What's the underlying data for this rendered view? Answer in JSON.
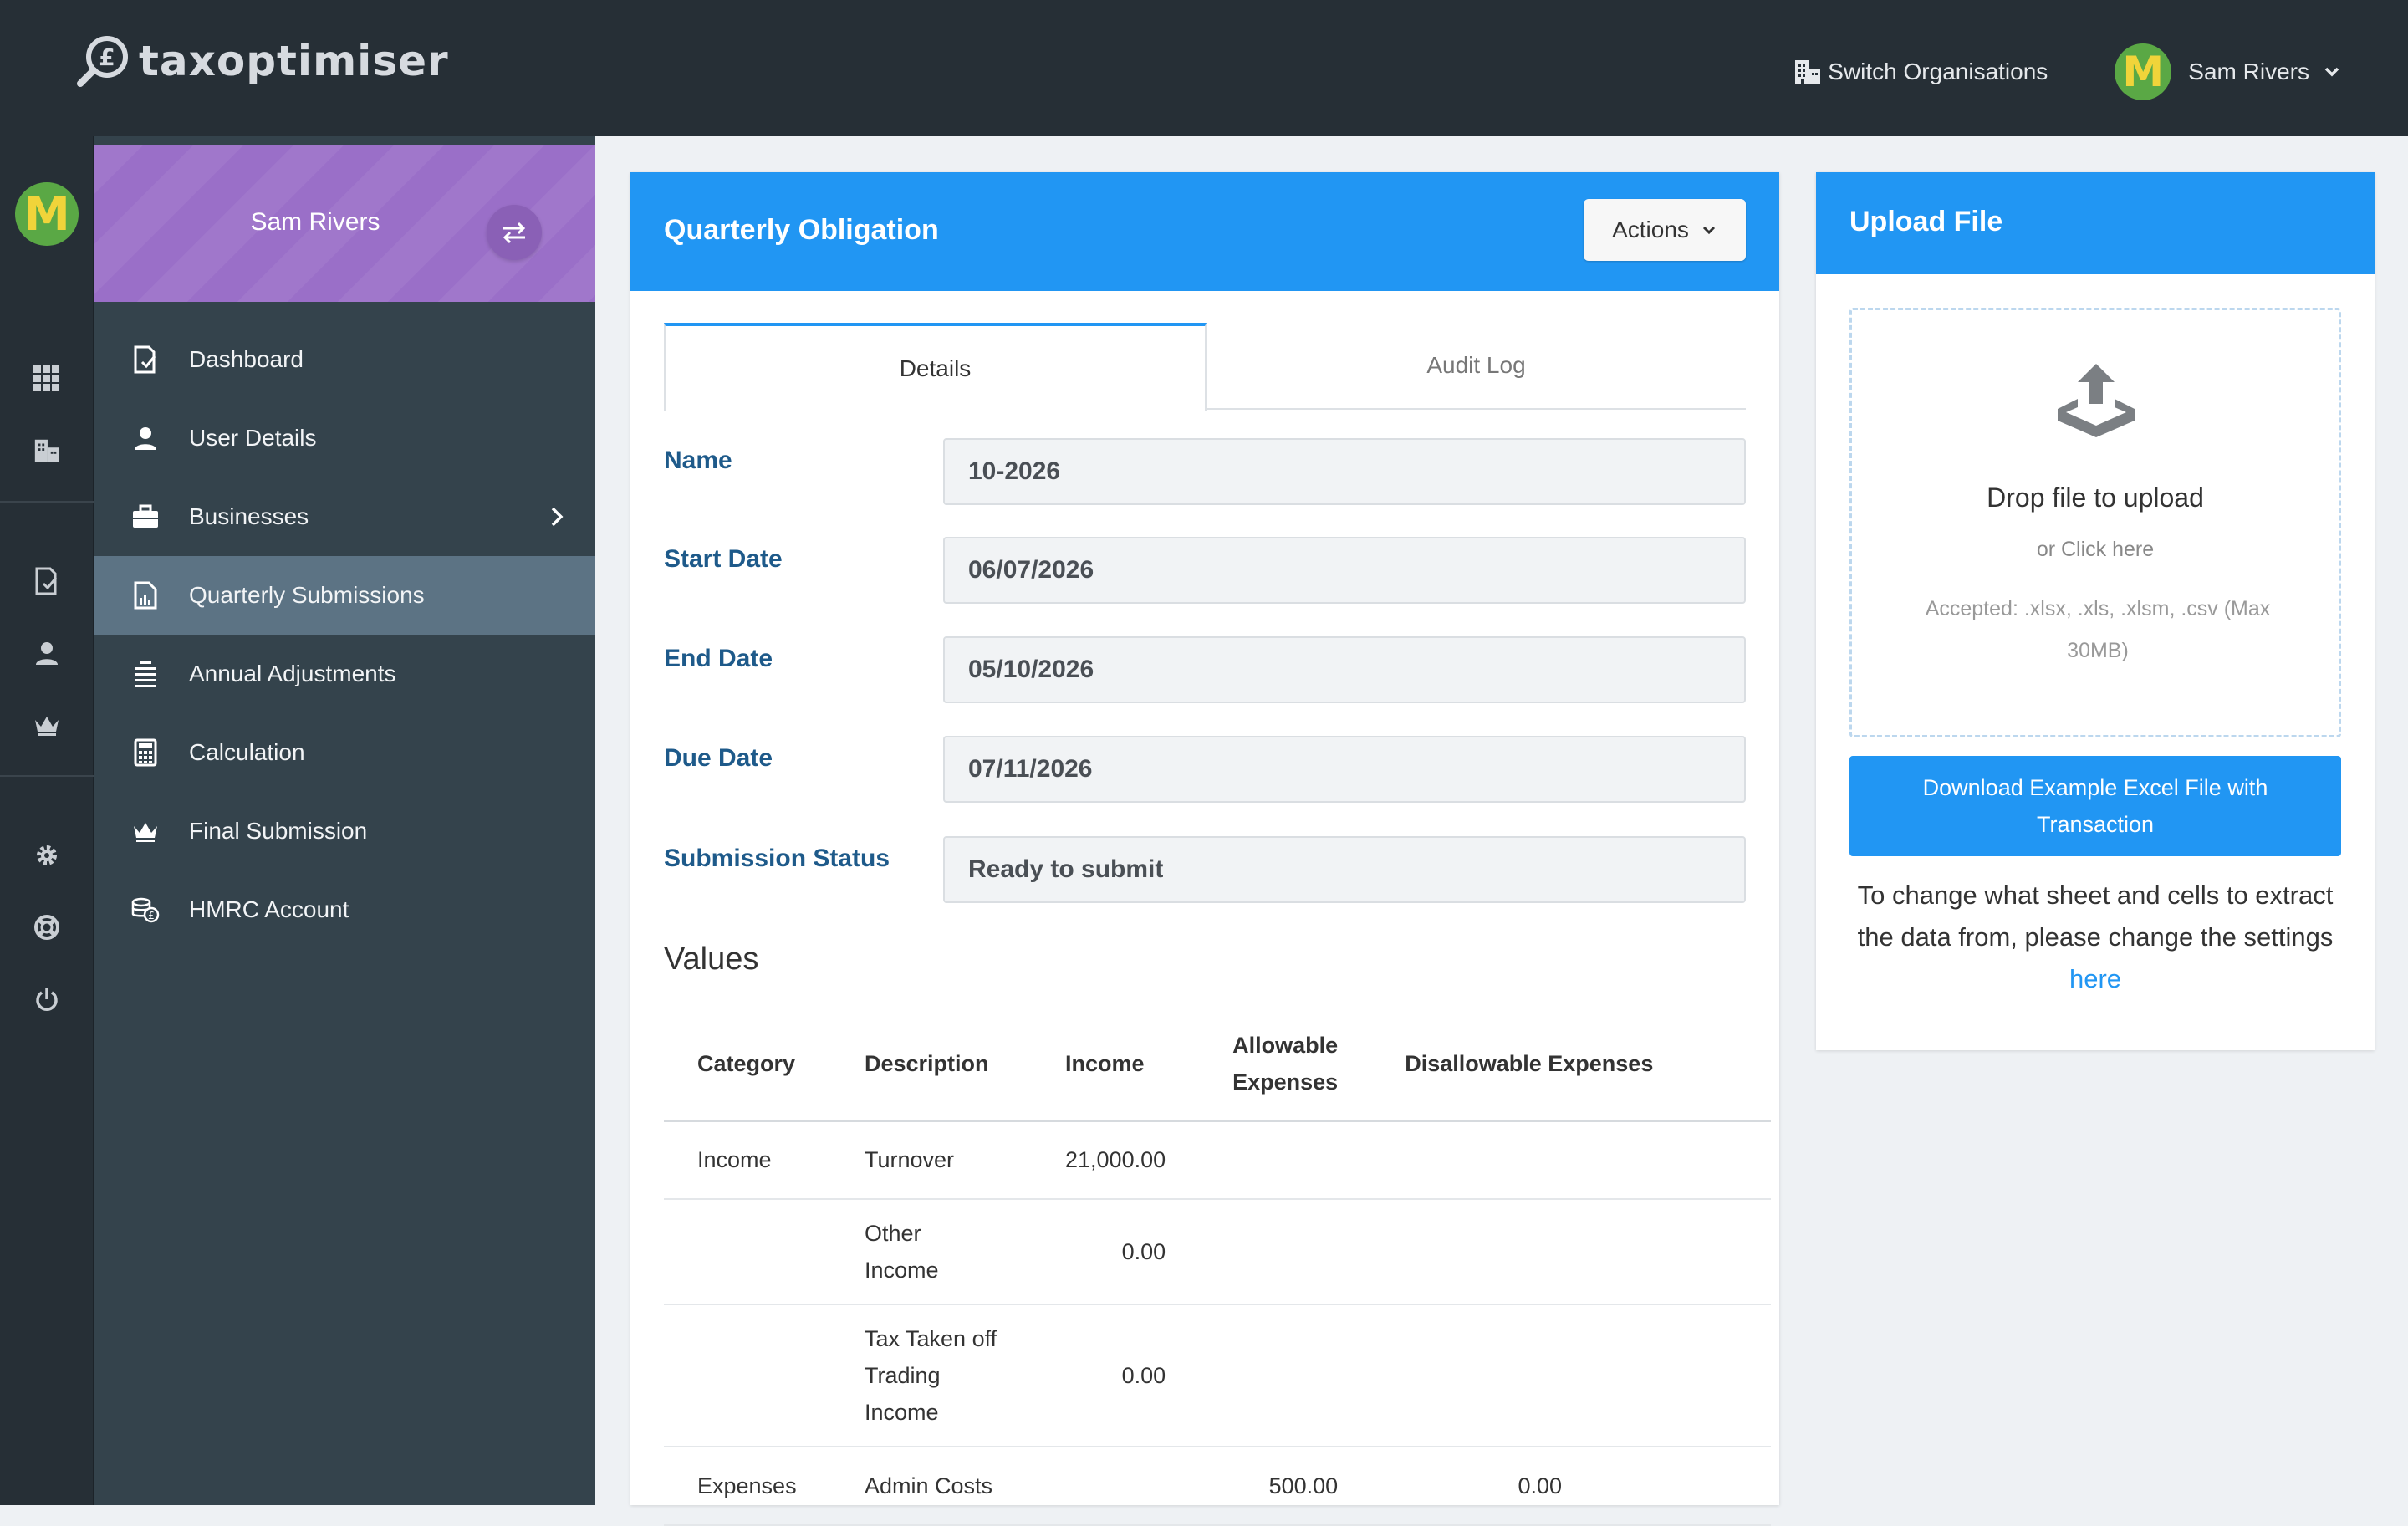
{
  "brand": {
    "logo_text": "taxoptimiser"
  },
  "topbar": {
    "switch_org_label": "Switch Organisations",
    "user_name": "Sam Rivers",
    "avatar_letter": "M"
  },
  "rail": {
    "avatar_letter": "M"
  },
  "sidebar": {
    "user_name": "Sam Rivers",
    "items": [
      {
        "label": "Dashboard",
        "icon": "document-check-icon"
      },
      {
        "label": "User Details",
        "icon": "user-icon"
      },
      {
        "label": "Businesses",
        "icon": "briefcase-icon"
      },
      {
        "label": "Quarterly Submissions",
        "icon": "report-icon",
        "active": true
      },
      {
        "label": "Annual Adjustments",
        "icon": "list-icon"
      },
      {
        "label": "Calculation",
        "icon": "calculator-icon"
      },
      {
        "label": "Final Submission",
        "icon": "crown-icon"
      },
      {
        "label": "HMRC Account",
        "icon": "coins-icon"
      }
    ]
  },
  "obligation": {
    "title": "Quarterly Obligation",
    "actions_label": "Actions",
    "tabs": [
      "Details",
      "Audit Log"
    ],
    "fields": [
      {
        "label": "Name",
        "value": "10-2026"
      },
      {
        "label": "Start Date",
        "value": "06/07/2026"
      },
      {
        "label": "End Date",
        "value": "05/10/2026"
      },
      {
        "label": "Due Date",
        "value": "07/11/2026"
      },
      {
        "label": "Submission Status",
        "value": "Ready to submit"
      }
    ],
    "values_title": "Values",
    "table": {
      "headers": [
        "Category",
        "Description",
        "Income",
        "Allowable Expenses",
        "Disallowable Expenses"
      ],
      "rows": [
        [
          "Income",
          "Turnover",
          "21,000.00",
          "",
          ""
        ],
        [
          "",
          "Other Income",
          "0.00",
          "",
          ""
        ],
        [
          "",
          "Tax Taken off Trading Income",
          "0.00",
          "",
          ""
        ],
        [
          "Expenses",
          "Admin Costs",
          "",
          "500.00",
          "0.00"
        ]
      ]
    }
  },
  "upload": {
    "title": "Upload File",
    "drop_title": "Drop file to upload",
    "drop_or": "or Click here",
    "accepted": "Accepted: .xlsx, .xls, .xlsm, .csv (Max 30MB)",
    "download_label": "Download Example Excel File with Transaction",
    "note_text": "To change what sheet and cells to extract the data from, please change the settings",
    "note_link": "here"
  },
  "colors": {
    "topbar": "#262f36",
    "sidebar": "#34434c",
    "sidebar_header": "#9a6fc8",
    "accent": "#2196f3",
    "label": "#1e5a8a"
  }
}
